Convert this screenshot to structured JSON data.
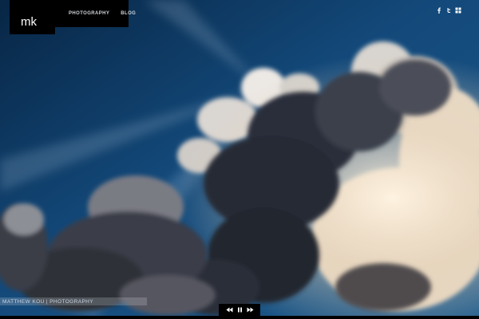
{
  "brand": {
    "logo": "mk"
  },
  "nav": {
    "items": [
      {
        "label": "PHOTOGRAPHY"
      },
      {
        "label": "BLOG"
      }
    ]
  },
  "social": {
    "icons": [
      "facebook-icon",
      "twitter-icon",
      "flickr-icon"
    ]
  },
  "footer": {
    "credit": "MATTHEW KOU | PHOTOGRAPHY"
  },
  "slideshow": {
    "controls": [
      "previous-icon",
      "pause-icon",
      "next-icon"
    ]
  },
  "colors": {
    "sky": "#0f3a63",
    "panel": "#000000",
    "text": "#ffffff"
  }
}
